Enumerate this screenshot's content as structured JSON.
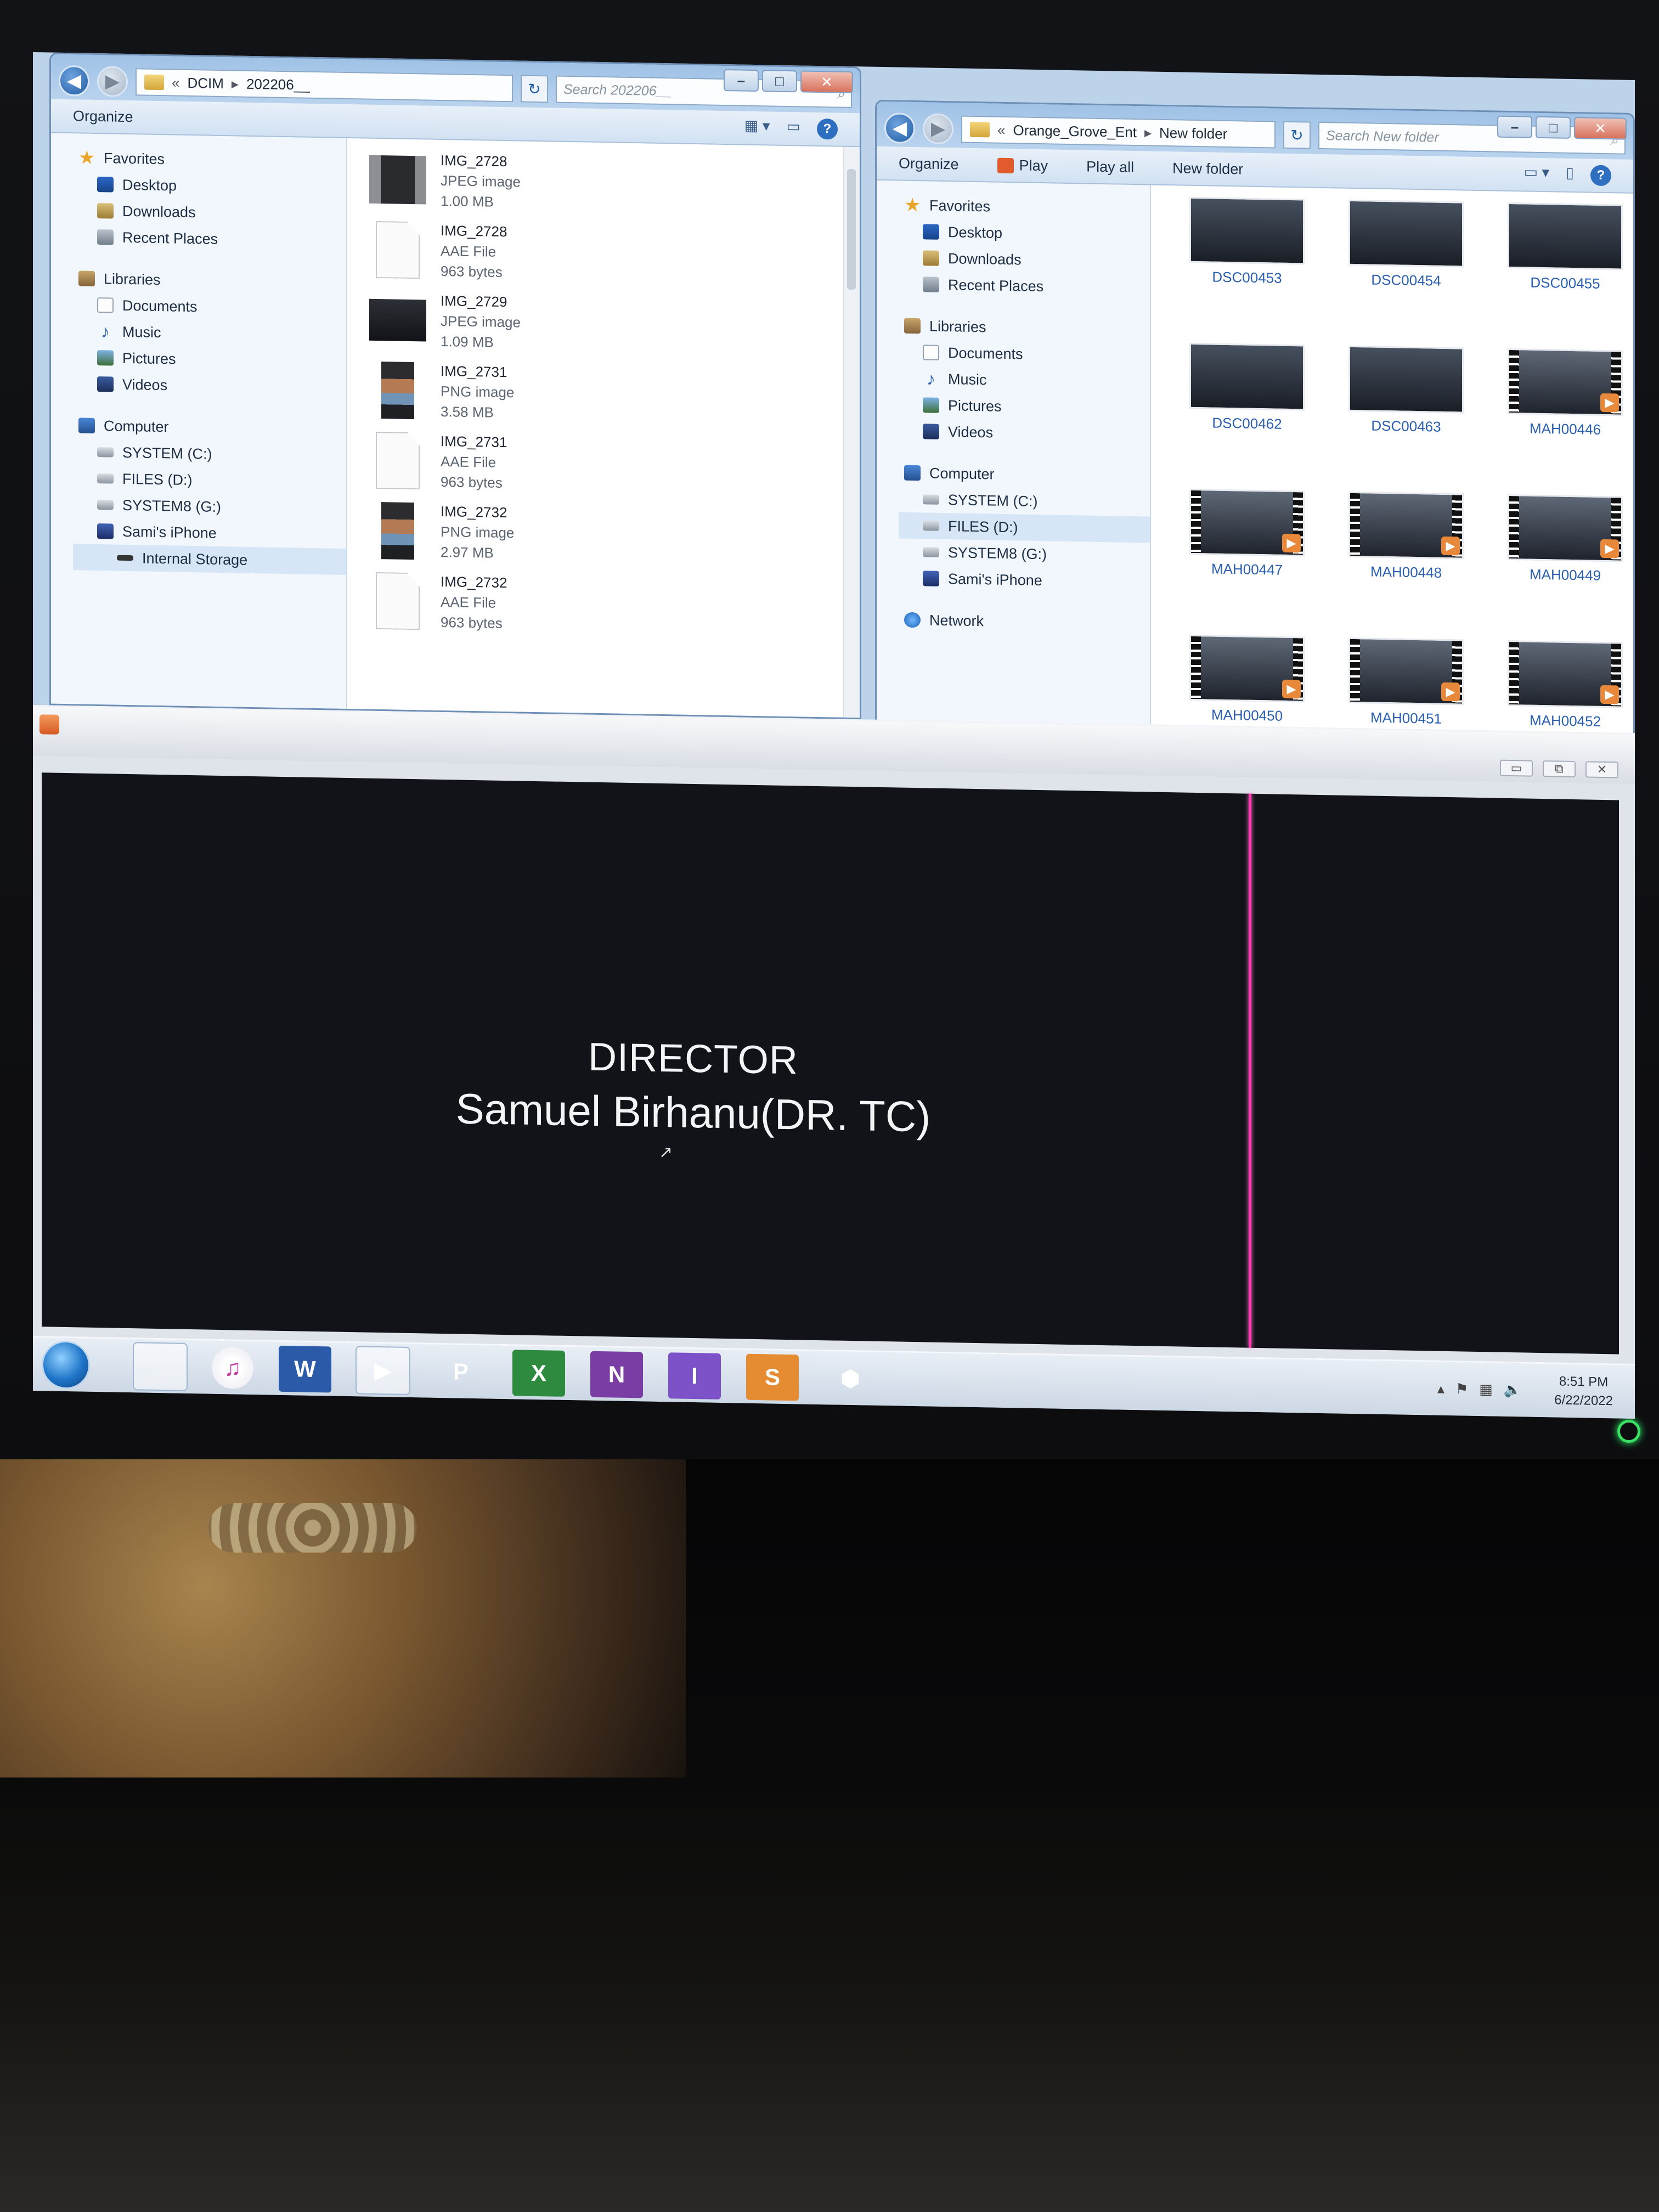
{
  "left_explorer": {
    "breadcrumb": [
      "DCIM",
      "202206__"
    ],
    "search_placeholder": "Search 202206__",
    "toolbar": {
      "organize": "Organize"
    },
    "nav": {
      "favorites": {
        "label": "Favorites",
        "items": [
          "Desktop",
          "Downloads",
          "Recent Places"
        ]
      },
      "libraries": {
        "label": "Libraries",
        "items": [
          "Documents",
          "Music",
          "Pictures",
          "Videos"
        ]
      },
      "computer": {
        "label": "Computer",
        "items": [
          "SYSTEM (C:)",
          "FILES (D:)",
          "SYSTEM8 (G:)",
          "Sami's iPhone"
        ]
      },
      "internal_storage": "Internal Storage"
    },
    "files": [
      {
        "name": "IMG_2728",
        "type": "JPEG image",
        "size": "1.00 MB",
        "thumb": "photo-mixed"
      },
      {
        "name": "IMG_2728",
        "type": "AAE File",
        "size": "963 bytes",
        "thumb": "blank"
      },
      {
        "name": "IMG_2729",
        "type": "JPEG image",
        "size": "1.09 MB",
        "thumb": "photo-dark"
      },
      {
        "name": "IMG_2731",
        "type": "PNG image",
        "size": "3.58 MB",
        "thumb": "png-shot"
      },
      {
        "name": "IMG_2731",
        "type": "AAE File",
        "size": "963 bytes",
        "thumb": "blank"
      },
      {
        "name": "IMG_2732",
        "type": "PNG image",
        "size": "2.97 MB",
        "thumb": "png-shot"
      },
      {
        "name": "IMG_2732",
        "type": "AAE File",
        "size": "963 bytes",
        "thumb": "blank"
      }
    ]
  },
  "right_explorer": {
    "breadcrumb": [
      "Orange_Grove_Ent",
      "New folder"
    ],
    "search_placeholder": "Search New folder",
    "toolbar": {
      "organize": "Organize",
      "play": "Play",
      "play_all": "Play all",
      "new_folder": "New folder"
    },
    "nav": {
      "favorites": {
        "label": "Favorites",
        "items": [
          "Desktop",
          "Downloads",
          "Recent Places"
        ]
      },
      "libraries": {
        "label": "Libraries",
        "items": [
          "Documents",
          "Music",
          "Pictures",
          "Videos"
        ]
      },
      "computer": {
        "label": "Computer",
        "items": [
          "SYSTEM (C:)",
          "FILES (D:)",
          "SYSTEM8 (G:)",
          "Sami's iPhone"
        ]
      },
      "network": "Network"
    },
    "tiles": [
      {
        "name": "DSC00453",
        "kind": "photo"
      },
      {
        "name": "DSC00454",
        "kind": "photo"
      },
      {
        "name": "DSC00455",
        "kind": "photo"
      },
      {
        "name": "DSC00462",
        "kind": "photo"
      },
      {
        "name": "DSC00463",
        "kind": "photo"
      },
      {
        "name": "MAH00446",
        "kind": "video"
      },
      {
        "name": "MAH00447",
        "kind": "video"
      },
      {
        "name": "MAH00448",
        "kind": "video"
      },
      {
        "name": "MAH00449",
        "kind": "video"
      },
      {
        "name": "MAH00450",
        "kind": "video"
      },
      {
        "name": "MAH00451",
        "kind": "video"
      },
      {
        "name": "MAH00452",
        "kind": "video"
      }
    ]
  },
  "media_player": {
    "credit_role": "DIRECTOR",
    "credit_name": "Samuel Birhanu(DR. TC)"
  },
  "taskbar": {
    "apps": [
      {
        "name": "explorer",
        "glyph": ""
      },
      {
        "name": "itunes",
        "glyph": "♫"
      },
      {
        "name": "word",
        "glyph": "W"
      },
      {
        "name": "media",
        "glyph": "▶"
      },
      {
        "name": "powerpoint",
        "glyph": "P"
      },
      {
        "name": "excel",
        "glyph": "X"
      },
      {
        "name": "onenote",
        "glyph": "N"
      },
      {
        "name": "infopath",
        "glyph": "I"
      },
      {
        "name": "sway",
        "glyph": "S"
      },
      {
        "name": "virtualbox",
        "glyph": "⬢"
      }
    ],
    "clock_time": "8:51 PM",
    "clock_date": "6/22/2022"
  }
}
